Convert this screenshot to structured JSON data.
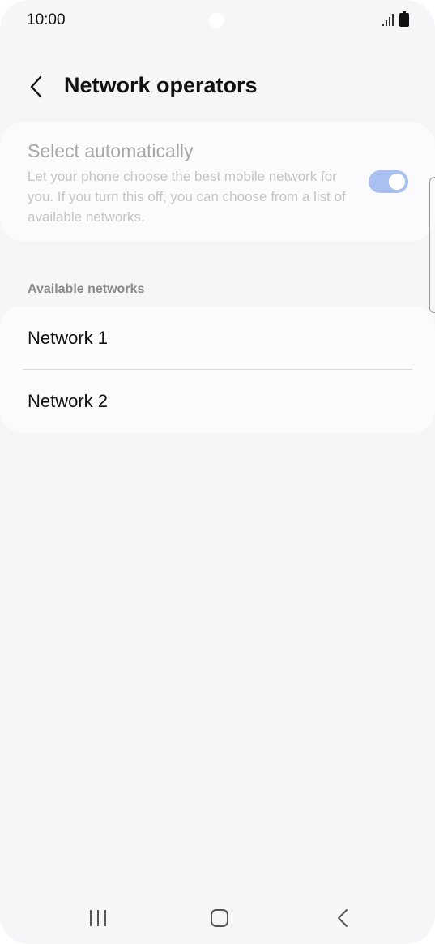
{
  "status_bar": {
    "time": "10:00"
  },
  "header": {
    "title": "Network operators",
    "back_icon": "chevron-left-icon"
  },
  "auto_select": {
    "title": "Select automatically",
    "description": "Let your phone choose the best mobile network for you. If you turn this off, you can choose from a list of available networks.",
    "enabled": true,
    "toggle_color": "#a9c0f1"
  },
  "available_networks": {
    "header": "Available networks",
    "items": [
      {
        "label": "Network 1"
      },
      {
        "label": "Network 2"
      }
    ]
  },
  "nav_bar": {
    "icons": [
      "recents-icon",
      "home-icon",
      "back-icon"
    ]
  },
  "colors": {
    "background": "#f6f6f8",
    "card": "#fbfbfd",
    "accent": "#a9c0f1"
  }
}
